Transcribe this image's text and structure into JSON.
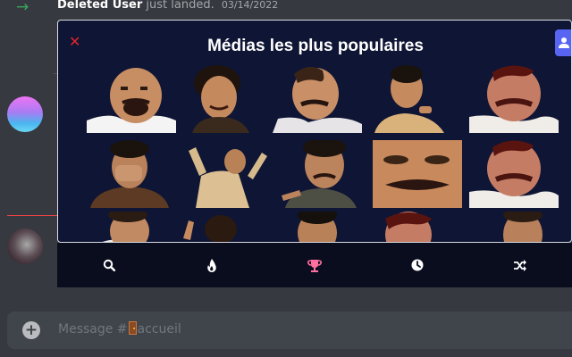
{
  "system_message": {
    "username": "Deleted User",
    "text": "just landed.",
    "date": "03/14/2022"
  },
  "popup": {
    "title": "Médias les plus populaires",
    "close_symbol": "✕"
  },
  "media_items": [
    {
      "label": "laughing-man-thumbnail",
      "row": 1
    },
    {
      "label": "laughing-man-thumbnail",
      "row": 1
    },
    {
      "label": "laughing-man-thumbnail",
      "row": 1
    },
    {
      "label": "laughing-man-thumbnail",
      "row": 1
    },
    {
      "label": "laughing-man-thumbnail",
      "row": 1
    },
    {
      "label": "laughing-man-thumbnail",
      "row": 2
    },
    {
      "label": "laughing-man-thumbnail",
      "row": 2
    },
    {
      "label": "laughing-man-thumbnail",
      "row": 2
    },
    {
      "label": "laughing-man-thumbnail",
      "row": 2
    },
    {
      "label": "laughing-man-thumbnail",
      "row": 2
    },
    {
      "label": "laughing-man-thumbnail",
      "row": 3
    },
    {
      "label": "laughing-man-thumbnail",
      "row": 3
    },
    {
      "label": "laughing-man-thumbnail",
      "row": 3
    },
    {
      "label": "laughing-man-thumbnail",
      "row": 3
    },
    {
      "label": "laughing-man-thumbnail",
      "row": 3
    }
  ],
  "tabs": [
    {
      "name": "search-icon",
      "color": "#ffffff"
    },
    {
      "name": "flame-icon",
      "color": "#ffffff"
    },
    {
      "name": "trophy-icon",
      "color": "#ff6fa0"
    },
    {
      "name": "clock-icon",
      "color": "#ffffff"
    },
    {
      "name": "shuffle-icon",
      "color": "#ffffff"
    }
  ],
  "message_box": {
    "placeholder_prefix": "Message #",
    "channel": "accueil"
  },
  "colors": {
    "background": "#36393f",
    "popup_bg": "#0f1534",
    "accent": "#5865f2",
    "close_red": "#e0252b",
    "trophy_pink": "#ff6fa0"
  }
}
